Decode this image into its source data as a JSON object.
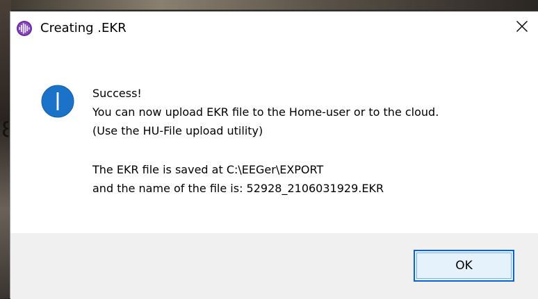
{
  "window": {
    "title": "Creating .EKR",
    "app_icon": "waveform-app-icon",
    "close_icon": "close-icon"
  },
  "message": {
    "icon": "info-icon",
    "lines": [
      "Success!",
      "You can now upload EKR file to the Home-user or to the cloud.",
      "(Use the HU-File upload utility)",
      "",
      "The EKR file is saved at C:\\EEGer\\EXPORT",
      "and the name of the file is: 52928_2106031929.EKR"
    ]
  },
  "buttons": {
    "ok_label": "OK"
  },
  "colors": {
    "info_blue": "#1a73c8",
    "button_border": "#0a63cf",
    "button_fill": "#e5f1fb",
    "footer_bg": "#f0f0f0"
  }
}
